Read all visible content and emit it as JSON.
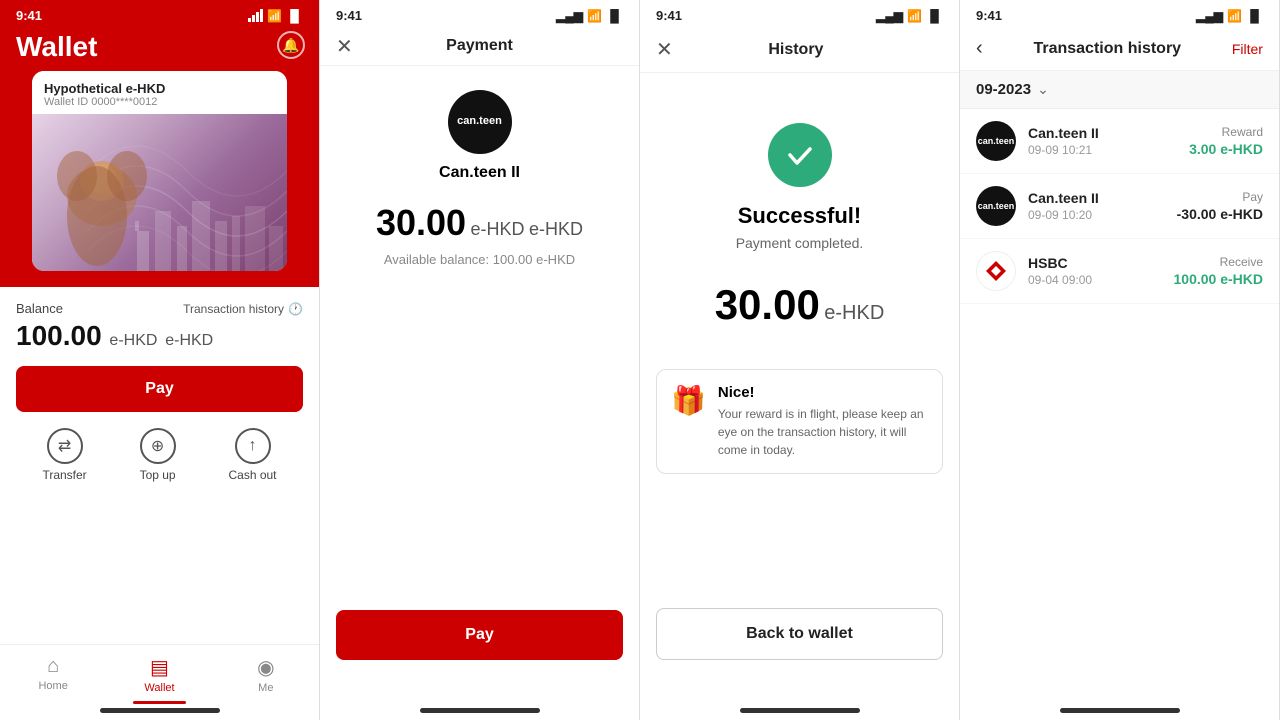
{
  "screens": {
    "wallet": {
      "status_time": "9:41",
      "title": "Wallet",
      "card": {
        "title": "Hypothetical e-HKD",
        "id": "Wallet ID 0000****0012"
      },
      "balance_label": "Balance",
      "tx_history_label": "Transaction history",
      "balance_amount": "100.00",
      "balance_unit": "e-HKD",
      "pay_label": "Pay",
      "actions": [
        {
          "label": "Transfer",
          "icon": "⇄"
        },
        {
          "label": "Top up",
          "icon": "⊕"
        },
        {
          "label": "Cash out",
          "icon": "↑"
        }
      ],
      "nav": [
        {
          "label": "Home",
          "icon": "⌂"
        },
        {
          "label": "Wallet",
          "icon": "▤",
          "active": true
        },
        {
          "label": "Me",
          "icon": "◉"
        }
      ]
    },
    "payment": {
      "status_time": "9:41",
      "header_title": "Payment",
      "merchant_name": "Can.teen II",
      "merchant_initials": "can.teen",
      "amount": "30.00",
      "amount_unit": "e-HKD",
      "available_balance": "Available balance: 100.00 e-HKD",
      "pay_label": "Pay"
    },
    "success": {
      "status_time": "9:41",
      "header_title": "History",
      "title": "Successful!",
      "subtitle": "Payment completed.",
      "amount": "30.00",
      "amount_unit": "e-HKD",
      "reward_title": "Nice!",
      "reward_body": "Your reward is in flight, please keep an eye on the transaction history, it will come in today.",
      "back_label": "Back to wallet"
    },
    "history": {
      "status_time": "9:41",
      "header_title": "Transaction history",
      "filter_label": "Filter",
      "month": "09-2023",
      "transactions": [
        {
          "name": "Can.teen II",
          "date": "09-09 10:21",
          "type": "Reward",
          "amount": "3.00 e-HKD",
          "positive": true,
          "initials": "can.teen"
        },
        {
          "name": "Can.teen II",
          "date": "09-09 10:20",
          "type": "Pay",
          "amount": "-30.00 e-HKD",
          "positive": false,
          "initials": "can.teen"
        },
        {
          "name": "HSBC",
          "date": "09-04 09:00",
          "type": "Receive",
          "amount": "100.00 e-HKD",
          "positive": true,
          "initials": "HSBC",
          "is_hsbc": true
        }
      ]
    }
  }
}
